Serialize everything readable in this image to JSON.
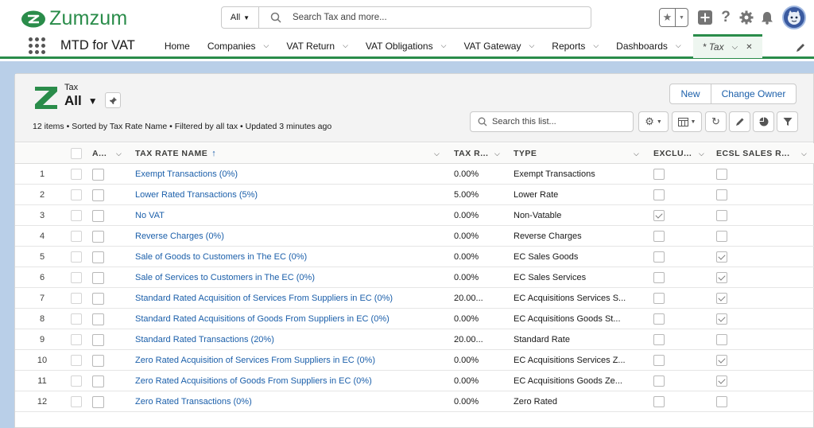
{
  "app": {
    "brand": "Zumzum",
    "app_name": "MTD for VAT",
    "search_scope": "All",
    "search_placeholder": "Search Tax and more..."
  },
  "nav": {
    "items": [
      {
        "label": "Home",
        "has_menu": false
      },
      {
        "label": "Companies",
        "has_menu": true
      },
      {
        "label": "VAT Return",
        "has_menu": true
      },
      {
        "label": "VAT Obligations",
        "has_menu": true
      },
      {
        "label": "VAT Gateway",
        "has_menu": true
      },
      {
        "label": "Reports",
        "has_menu": true
      },
      {
        "label": "Dashboards",
        "has_menu": true
      }
    ],
    "active_tab": "* Tax"
  },
  "list": {
    "object_label": "Tax",
    "view_name": "All",
    "summary": "12 items • Sorted by Tax Rate Name • Filtered by all tax • Updated 3 minutes ago",
    "new_label": "New",
    "change_owner_label": "Change Owner",
    "search_placeholder": "Search this list..."
  },
  "columns": {
    "a": "A...",
    "name": "TAX RATE NAME",
    "rate": "TAX R...",
    "type": "TYPE",
    "exclu": "EXCLU...",
    "ecsl": "ECSL SALES R..."
  },
  "rows": [
    {
      "num": "1",
      "name": "Exempt Transactions (0%)",
      "rate": "0.00%",
      "type": "Exempt Transactions",
      "exclu": false,
      "ecsl": false
    },
    {
      "num": "2",
      "name": "Lower Rated Transactions (5%)",
      "rate": "5.00%",
      "type": "Lower Rate",
      "exclu": false,
      "ecsl": false
    },
    {
      "num": "3",
      "name": "No VAT",
      "rate": "0.00%",
      "type": "Non-Vatable",
      "exclu": true,
      "ecsl": false
    },
    {
      "num": "4",
      "name": "Reverse Charges (0%)",
      "rate": "0.00%",
      "type": "Reverse Charges",
      "exclu": false,
      "ecsl": false
    },
    {
      "num": "5",
      "name": "Sale of Goods to Customers in The EC (0%)",
      "rate": "0.00%",
      "type": "EC Sales Goods",
      "exclu": false,
      "ecsl": true
    },
    {
      "num": "6",
      "name": "Sale of Services to Customers in The EC (0%)",
      "rate": "0.00%",
      "type": "EC Sales Services",
      "exclu": false,
      "ecsl": true
    },
    {
      "num": "7",
      "name": "Standard Rated Acquisition of Services From Suppliers in EC (0%)",
      "rate": "20.00...",
      "type": "EC Acquisitions Services S...",
      "exclu": false,
      "ecsl": true
    },
    {
      "num": "8",
      "name": "Standard Rated Acquisitions of Goods From Suppliers in EC (0%)",
      "rate": "0.00%",
      "type": "EC Acquisitions Goods St...",
      "exclu": false,
      "ecsl": true
    },
    {
      "num": "9",
      "name": "Standard Rated Transactions (20%)",
      "rate": "20.00...",
      "type": "Standard Rate",
      "exclu": false,
      "ecsl": false
    },
    {
      "num": "10",
      "name": "Zero Rated Acquisition of Services From Suppliers in EC (0%)",
      "rate": "0.00%",
      "type": "EC Acquisitions Services Z...",
      "exclu": false,
      "ecsl": true
    },
    {
      "num": "11",
      "name": "Zero Rated Acquisitions of Goods From Suppliers in EC (0%)",
      "rate": "0.00%",
      "type": "EC Acquisitions Goods Ze...",
      "exclu": false,
      "ecsl": true
    },
    {
      "num": "12",
      "name": "Zero Rated Transactions (0%)",
      "rate": "0.00%",
      "type": "Zero Rated",
      "exclu": false,
      "ecsl": false
    }
  ],
  "colors": {
    "brand_green": "#2a8c4a",
    "link_blue": "#1b5faa",
    "backdrop": "#b9cfe8"
  }
}
